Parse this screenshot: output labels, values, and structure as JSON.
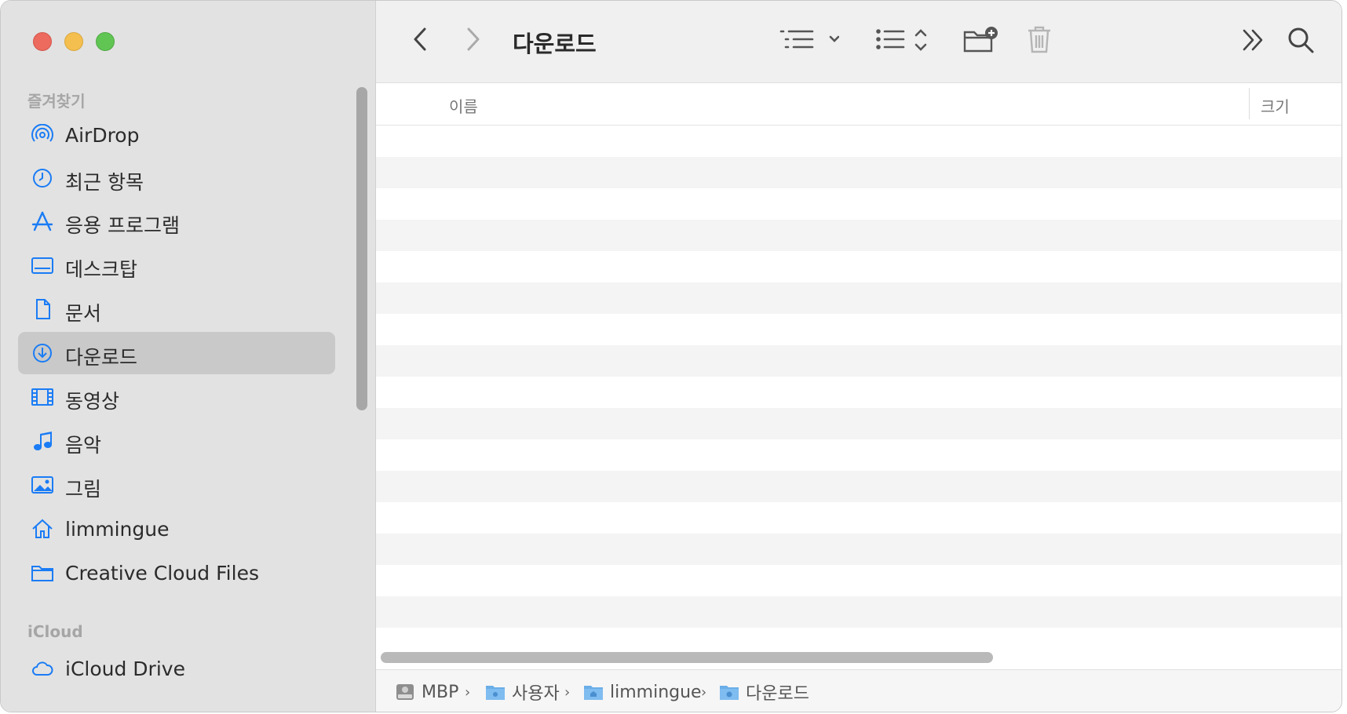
{
  "window": {
    "title": "다운로드"
  },
  "sidebar": {
    "favorites_title": "즐겨찾기",
    "icloud_title": "iCloud",
    "items": [
      {
        "label": "AirDrop",
        "icon": "airdrop-icon"
      },
      {
        "label": "최근 항목",
        "icon": "clock-icon"
      },
      {
        "label": "응용 프로그램",
        "icon": "apps-icon"
      },
      {
        "label": "데스크탑",
        "icon": "desktop-icon"
      },
      {
        "label": "문서",
        "icon": "document-icon"
      },
      {
        "label": "다운로드",
        "icon": "download-icon",
        "selected": true
      },
      {
        "label": "동영상",
        "icon": "film-icon"
      },
      {
        "label": "음악",
        "icon": "music-icon"
      },
      {
        "label": "그림",
        "icon": "photo-icon"
      },
      {
        "label": "limmingue",
        "icon": "home-icon"
      },
      {
        "label": "Creative Cloud Files",
        "icon": "folder-icon"
      }
    ],
    "icloud_items": [
      {
        "label": "iCloud Drive",
        "icon": "cloud-icon"
      }
    ]
  },
  "list": {
    "col_name": "이름",
    "col_size": "크기"
  },
  "pathbar": {
    "crumbs": [
      "MBP",
      "사용자",
      "limmingue",
      "다운로드"
    ],
    "separator": "›"
  },
  "colors": {
    "accent": "#1a7cf5",
    "sidebar_bg": "#e2e2e2",
    "selected_bg": "#c9c9c9"
  }
}
